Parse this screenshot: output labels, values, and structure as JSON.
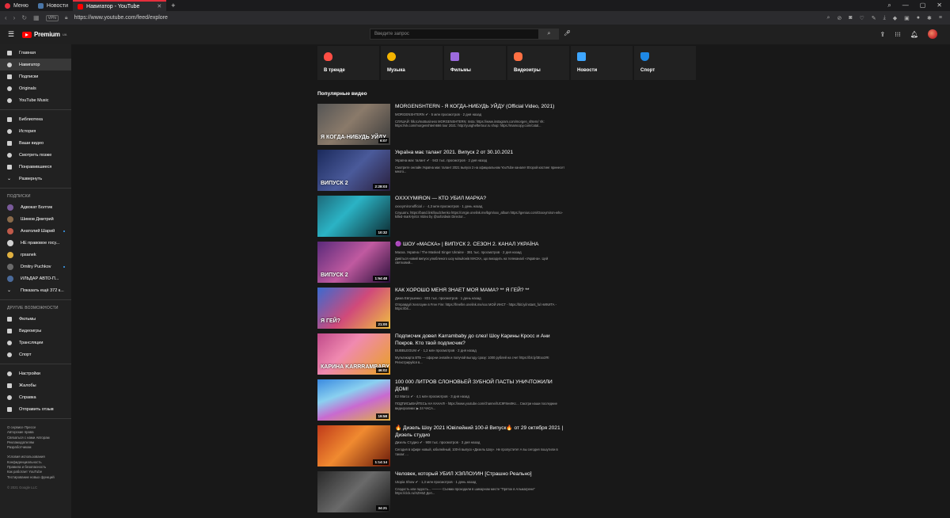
{
  "browser": {
    "tabs": [
      {
        "label": "Меню"
      },
      {
        "label": "Новости"
      },
      {
        "label": "Навигатор - YouTube"
      }
    ],
    "url": "https://www.youtube.com/feed/explore",
    "vpn_label": "VPN"
  },
  "header": {
    "logo_text": "Premium",
    "logo_region": "UA",
    "search_placeholder": "Введите запрос"
  },
  "sidebar": {
    "main": [
      {
        "label": "Главная"
      },
      {
        "label": "Навигатор"
      },
      {
        "label": "Подписки"
      },
      {
        "label": "Originals"
      },
      {
        "label": "YouTube Music"
      }
    ],
    "library": [
      {
        "label": "Библиотека"
      },
      {
        "label": "История"
      },
      {
        "label": "Ваши видео"
      },
      {
        "label": "Смотреть позже"
      },
      {
        "label": "Понравившиеся"
      },
      {
        "label": "Развернуть"
      }
    ],
    "subs_heading": "ПОДПИСКИ",
    "subscriptions": [
      {
        "label": "Адвокат Болтик"
      },
      {
        "label": "Шимов Дмитрий"
      },
      {
        "label": "Анатолий Шарий"
      },
      {
        "label": "НЕ правовое госу..."
      },
      {
        "label": "rpsanek"
      },
      {
        "label": "Dmitry Puchkov"
      },
      {
        "label": "ИЛЬДАР АВТО-П..."
      },
      {
        "label": "Показать ещё 372 к..."
      }
    ],
    "more_heading": "ДРУГИЕ ВОЗМОЖНОСТИ",
    "more": [
      {
        "label": "Фильмы"
      },
      {
        "label": "Видеоигры"
      },
      {
        "label": "Трансляции"
      },
      {
        "label": "Спорт"
      }
    ],
    "settings": [
      {
        "label": "Настройки"
      },
      {
        "label": "Жалобы"
      },
      {
        "label": "Справка"
      },
      {
        "label": "Отправить отзыв"
      }
    ],
    "footer1": [
      "О сервисе  Прессе",
      "Авторские права",
      "Связаться с нами  Авторам",
      "Рекламодателям",
      "Разработчикам"
    ],
    "footer2": [
      "Условия использования",
      "Конфиденциальность",
      "Правила и безопасность",
      "Как работает YouTube",
      "Тестирование новых функций"
    ],
    "copyright": "© 2021 Google LLC"
  },
  "categories": [
    {
      "label": "В тренде",
      "color": "#ff4e45"
    },
    {
      "label": "Музыка",
      "color": "#f4b400"
    },
    {
      "label": "Фильмы",
      "color": "#9c6ade"
    },
    {
      "label": "Видеоигры",
      "color": "#ff7043"
    },
    {
      "label": "Новости",
      "color": "#3ea6ff"
    },
    {
      "label": "Спорт",
      "color": "#1e88e5"
    }
  ],
  "section_title": "Популярные видео",
  "videos": [
    {
      "title": "MORGENSHTERN - Я КОГДА-НИБУДЬ УЙДУ (Official Video, 2021)",
      "meta": "MORGENSHTERN ✔ · 5 млн просмотров · 2 дня назад",
      "desc": "СЛУШАЙ: hlk.to/moBusiness MORGENSHTERN: Insta: https://www.instagram.com/morgen_shtern/ Vk: https://vk.com/morgenshtern666 tour 2021: http://yungheftertour.ru shop: https://mamcopy.com/catal...",
      "duration": "6:07",
      "thumb_text": "Я КОГДА-НИБУДЬ УЙДУ",
      "thumb_bg": "linear-gradient(135deg,#555 0%,#8a7a6a 45%,#3a3a3a 100%)"
    },
    {
      "title": "Україна має талант 2021. Випуск 2 от 30.10.2021",
      "meta": "Україна має талант ✔ · 943 тыс. просмотров · 2 дня назад",
      "desc": "Смотрите онлайн Україна має талант 2021 выпуск 2 на официальном YouTube канале! Второй кастинг принесет много...",
      "duration": "2:28:03",
      "thumb_text": "ВИПУСК 2",
      "thumb_bg": "linear-gradient(135deg,#1b2a5c 0%,#4a5a9a 50%,#2a1f3d 100%)"
    },
    {
      "title": "OXXXYMIRON — КТО УБИЛ МАРКА?",
      "meta": "oxxxymironofficial ♪ · 4,3 млн просмотров · 1 день назад",
      "desc": "Слушать: https://band.link/loudchenko https://orrgie.onelink.me/bgm/xxx_album https://genius.com/Oxxxymiron-who-killed-mark-lyrics Video by @oxfordwin Director...",
      "duration": "10:32",
      "thumb_text": "",
      "thumb_bg": "linear-gradient(135deg,#1d6a7a 0%,#2bb3c5 40%,#0d2a30 100%)"
    },
    {
      "title": "🟣 ШОУ «МАСКА» | ВИПУСК 2. СЕЗОН 2. КАНАЛ УКРАЇНА",
      "meta": "Маска. Україна / The Masked Singer Ukraine · 381 тыс. просмотров · 2 дня назад",
      "desc": "Дивіться новий випуск улюбленого шоу мільйонів МАСКА, що виходить на телеканалі «Україна». Цей святковий...",
      "duration": "1:54:48",
      "thumb_text": "ВИПУСК 2",
      "thumb_bg": "linear-gradient(135deg,#5a2a7a 0%,#c05aa0 50%,#2a0f3a 100%)"
    },
    {
      "title": "КАК ХОРОШО МЕНЯ ЗНАЕТ МОЯ МАМА? ** Я ГЕЙ? **",
      "meta": "Дима Евтушенко · 831 тыс. просмотров · 1 день назад",
      "desc": "Отправдуй Хеллоуин в Free Fire: https://freefire.onelink.me/xxx МОЙ ИНСТ - https://bit.ly/instant_ful НИКИТА - https://bit...",
      "duration": "21:00",
      "thumb_text": "Я ГЕЙ?",
      "thumb_bg": "linear-gradient(135deg,#3a6ad0 0%,#d04a7a 50%,#f0c040 100%)"
    },
    {
      "title": "Подписчик довел Karrambaby до слез! Шоу Карины Кросс и Ани Покров. Кто твой подписчик?",
      "meta": "BUBBLEGUM ✔ · 1,2 млн просмотров · 2 дня назад",
      "desc": "Мультикарта ВТБ — офорни онлайн и получай выгоду сразу: 1000 рублей на счет https://bit.ly/3Eox2RI Регистрируйся в...",
      "duration": "46:02",
      "thumb_text": "КАРИНА KARRRAMBABY",
      "thumb_bg": "linear-gradient(135deg,#c04a8a 0%,#f08ab0 40%,#e8a020 100%)"
    },
    {
      "title": "100 000 ЛИТРОВ СЛОНОВЬЕЙ ЗУБНОЙ ПАСТЫ УНИЧТОЖИЛИ ДОМ!",
      "meta": "Ez Marco ✔ · 4,1 млн просмотров · 3 дня назад",
      "desc": "ПОДПИСЫВАЙТЕСЬ НА КАНАЛ! - https://www.youtube.com/channel/UC9F8ev9Kc... Смотри наши последние видеоролики: ▶ 24 ЧАСА...",
      "duration": "19:58",
      "thumb_text": "",
      "thumb_bg": "linear-gradient(160deg,#3a8ae0 0%,#8ad0f0 35%,#c86ad0 60%,#e0b040 100%)"
    },
    {
      "title": "🔥 Дизель Шоу 2021 Ювілейний 100-й Випуск🔥 от 29 октября 2021 | Дизель студио",
      "meta": "Дизель Студио ✔ · 908 тыс. просмотров · 3 дня назад",
      "desc": "Сегодня в эфире новый, юбилейный, 100-й выпуск «Дизель Шоу». Не пропустите! А вы сегодня пошутили в таком: ...",
      "duration": "1:14:14",
      "thumb_text": "",
      "thumb_bg": "linear-gradient(135deg,#c03a1a 0%,#f08a30 45%,#6a1a0a 100%)"
    },
    {
      "title": "Человек, который УБИЛ ХЭЛЛОУИН [Страшно Реально]",
      "meta": "Utopia Show ✔ · 1,3 млн просмотров · 1 день назад",
      "desc": "Сладость или гадость... ——— Съемки проходили в шикарном месте \"Пряток в Альмагрене\" https://clck.ru/XZH6Z Доп...",
      "duration": "34:21",
      "thumb_text": "",
      "thumb_bg": "linear-gradient(135deg,#2a2a2a 0%,#6a6a6a 50%,#1a1a1a 100%)"
    }
  ]
}
